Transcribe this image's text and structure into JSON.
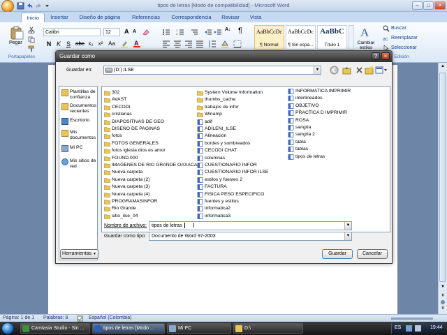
{
  "app": {
    "title": "tipos de letras [Modo de compatibilidad] - Microsoft Word",
    "office_button_icon": "office-logo-icon"
  },
  "ribbon": {
    "tabs": [
      "Inicio",
      "Insertar",
      "Diseño de página",
      "Referencias",
      "Correspondencia",
      "Revisar",
      "Vista"
    ],
    "active_tab": "Inicio",
    "paste_label": "Pegar",
    "clipboard_label": "Portapapeles",
    "font_name": "Calibri",
    "font_size": "12",
    "styles": [
      {
        "sample": "AaBbCcDc",
        "name": "¶ Normal"
      },
      {
        "sample": "AaBbCcDc",
        "name": "¶ Sin espa..."
      },
      {
        "sample": "AaBbC",
        "name": "Título 1"
      }
    ],
    "change_styles_label": "Cambiar estilos",
    "edit_search": "Buscar",
    "edit_replace": "Reemplazar",
    "edit_select": "Seleccionar",
    "edit_group_label": "Edición"
  },
  "dialog": {
    "title": "Guardar como",
    "save_in_label": "Guardar en:",
    "save_in_value": "(D:) ILSE",
    "places": [
      "Plantillas de confianza",
      "Documentos recientes",
      "Escritorio",
      "Mis documentos",
      "Mi PC",
      "Mis sitios de red"
    ],
    "files_col1": [
      {
        "name": "302",
        "type": "folder"
      },
      {
        "name": "AVAST",
        "type": "folder"
      },
      {
        "name": "CECODI",
        "type": "folder"
      },
      {
        "name": "cristianas",
        "type": "folder"
      },
      {
        "name": "DIAPOSITIVAS DE GEO",
        "type": "folder"
      },
      {
        "name": "DISEÑO DE PAGINAS",
        "type": "folder"
      },
      {
        "name": "fotos",
        "type": "folder"
      },
      {
        "name": "FOTOS GENERALES",
        "type": "folder"
      },
      {
        "name": "fotos iglesia dios es amor",
        "type": "folder"
      },
      {
        "name": "FOUND.000",
        "type": "folder"
      },
      {
        "name": "IMAGENES DE RIO GRANDE OAXACA",
        "type": "folder"
      },
      {
        "name": "Nueva carpeta",
        "type": "folder"
      },
      {
        "name": "Nueva carpeta (2)",
        "type": "folder"
      },
      {
        "name": "Nueva carpeta (3)",
        "type": "folder"
      },
      {
        "name": "Nueva carpeta (4)",
        "type": "folder"
      },
      {
        "name": "PROGRAMASINFOR",
        "type": "folder"
      },
      {
        "name": "Rio Grande",
        "type": "folder"
      },
      {
        "name": "sitio_ilse_04",
        "type": "folder"
      }
    ],
    "files_col2": [
      {
        "name": "System Volume Information",
        "type": "folder"
      },
      {
        "name": "thumbs_cache",
        "type": "folder"
      },
      {
        "name": "trabajos de infor",
        "type": "folder"
      },
      {
        "name": "Winamp",
        "type": "folder"
      },
      {
        "name": "adif",
        "type": "doc"
      },
      {
        "name": "ADILENI_ILSE",
        "type": "doc"
      },
      {
        "name": "Alineación",
        "type": "doc"
      },
      {
        "name": "bordes y sombreados",
        "type": "doc"
      },
      {
        "name": "CECODI CHAT",
        "type": "doc"
      },
      {
        "name": "columnas",
        "type": "doc"
      },
      {
        "name": "CUESTIONARIO INFOR",
        "type": "doc"
      },
      {
        "name": "CUESTIONARIO INFOR ILSE",
        "type": "doc"
      },
      {
        "name": "estilos y fuestes 2",
        "type": "doc"
      },
      {
        "name": "FACTURA",
        "type": "doc"
      },
      {
        "name": "FISICA PESO ESPECIFICO",
        "type": "doc"
      },
      {
        "name": "fuentes y estilos",
        "type": "doc"
      },
      {
        "name": "informatica2",
        "type": "doc"
      },
      {
        "name": "informatica3",
        "type": "doc"
      }
    ],
    "files_col3": [
      {
        "name": "INFORMATICA IMPRIMIR",
        "type": "doc"
      },
      {
        "name": "interlineados",
        "type": "doc"
      },
      {
        "name": "OBJETIVO",
        "type": "doc"
      },
      {
        "name": "PRACTICA D IMPRIMIR",
        "type": "doc"
      },
      {
        "name": "ROSA",
        "type": "doc"
      },
      {
        "name": "sangria",
        "type": "doc"
      },
      {
        "name": "sangria 2",
        "type": "doc"
      },
      {
        "name": "tabla",
        "type": "doc"
      },
      {
        "name": "tablas",
        "type": "doc"
      },
      {
        "name": "tipos de letras",
        "type": "doc"
      }
    ],
    "filename_label": "Nombre de archivo:",
    "filename_value": "tipos de letras",
    "filetype_label": "Guardar como tipo:",
    "filetype_value": "Documento de Word 97-2003",
    "tools_label": "Herramientas",
    "save_label": "Guardar",
    "cancel_label": "Cancelar"
  },
  "status": {
    "page": "Página: 1 de 1",
    "words": "Palabras: 8",
    "language": "Español (Colombia)"
  },
  "taskbar": {
    "tasks": [
      "Camtasia Studio - Sin ...",
      "tipos de letras [Modo ...",
      "Mi PC",
      "D:\\"
    ],
    "active_index": 1,
    "clock": "19:44"
  },
  "colors": {
    "ribbon_tab_text": "#15428b",
    "dialog_title_bar": "#3a3a3a",
    "doc_background": "#6d86a7",
    "folder_yellow": "#e8c55a",
    "doc_icon_blue": "#3d66b5"
  }
}
